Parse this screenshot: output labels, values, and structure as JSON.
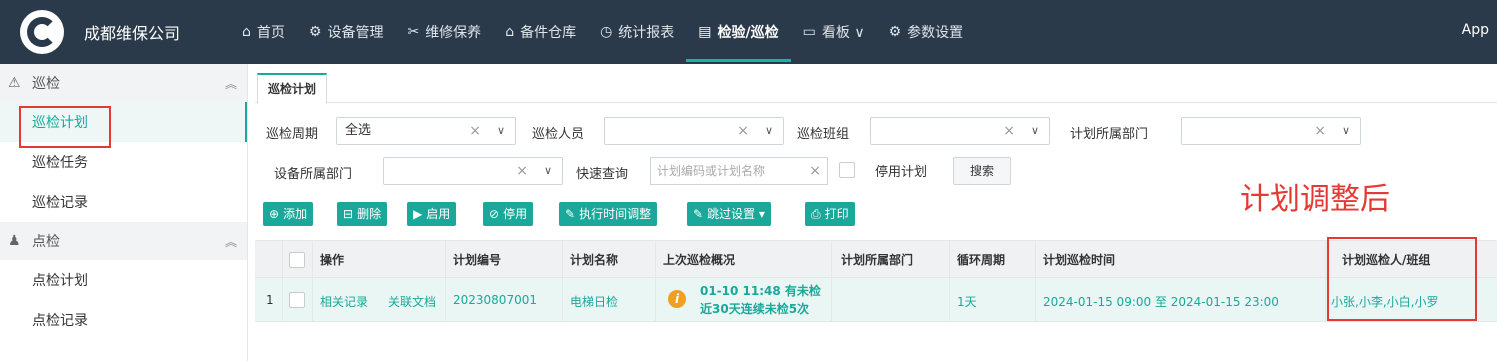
{
  "topbar": {
    "brand": "成都维保公司",
    "app_label": "App",
    "nav": [
      {
        "icon": "home-icon",
        "glyph": "⌂",
        "label": "首页"
      },
      {
        "icon": "device-icon",
        "glyph": "⚙",
        "label": "设备管理"
      },
      {
        "icon": "wrench-icon",
        "glyph": "✂",
        "label": "维修保养"
      },
      {
        "icon": "warehouse-icon",
        "glyph": "⌂",
        "label": "备件仓库"
      },
      {
        "icon": "clock-icon",
        "glyph": "◷",
        "label": "统计报表"
      },
      {
        "icon": "inspect-icon",
        "glyph": "▤",
        "label": "检验/巡检"
      },
      {
        "icon": "board-icon",
        "glyph": "▭",
        "label": "看板 ∨"
      },
      {
        "icon": "gear-icon",
        "glyph": "⚙",
        "label": "参数设置"
      }
    ]
  },
  "sidebar": {
    "group1": "巡检",
    "group1_items": [
      "巡检计划",
      "巡检任务",
      "巡检记录"
    ],
    "group2": "点检",
    "group2_items": [
      "点检计划",
      "点检记录"
    ]
  },
  "main": {
    "tab": "巡检计划",
    "filters": {
      "period_label": "巡检周期",
      "period_value": "全选",
      "person_label": "巡检人员",
      "team_label": "巡检班组",
      "plan_dept_label": "计划所属部门",
      "device_dept_label": "设备所属部门",
      "quick_label": "快速查询",
      "quick_placeholder": "计划编码或计划名称",
      "disabled_label": "停用计划",
      "search_button": "搜索"
    },
    "annotation": "计划调整后",
    "toolbar": [
      {
        "icon": "plus-icon",
        "glyph": "⊕",
        "label": "添加"
      },
      {
        "icon": "trash-icon",
        "glyph": "🗑",
        "label": "删除"
      },
      {
        "icon": "play-icon",
        "glyph": "▶",
        "label": "启用"
      },
      {
        "icon": "stop-icon",
        "glyph": "⊘",
        "label": "停用"
      },
      {
        "icon": "adjust-icon",
        "glyph": "✎",
        "label": "执行时间调整"
      },
      {
        "icon": "skip-icon",
        "glyph": "✎",
        "label": "跳过设置 ▾"
      },
      {
        "icon": "print-icon",
        "glyph": "⎙",
        "label": "打印"
      }
    ],
    "table": {
      "headers": [
        "操作",
        "计划编号",
        "计划名称",
        "上次巡检概况",
        "计划所属部门",
        "循环周期",
        "计划巡检时间",
        "计划巡检人/班组"
      ],
      "row": {
        "index": "1",
        "action1": "相关记录",
        "action2": "关联文档",
        "code": "20230807001",
        "name": "电梯日检",
        "summary_line1": "01-10 11:48 有未检",
        "summary_line2": "近30天连续未检5次",
        "dept": "",
        "cycle": "1天",
        "time": "2024-01-15 09:00 至 2024-01-15 23:00",
        "people": "小张,小李,小白,小罗"
      }
    }
  }
}
